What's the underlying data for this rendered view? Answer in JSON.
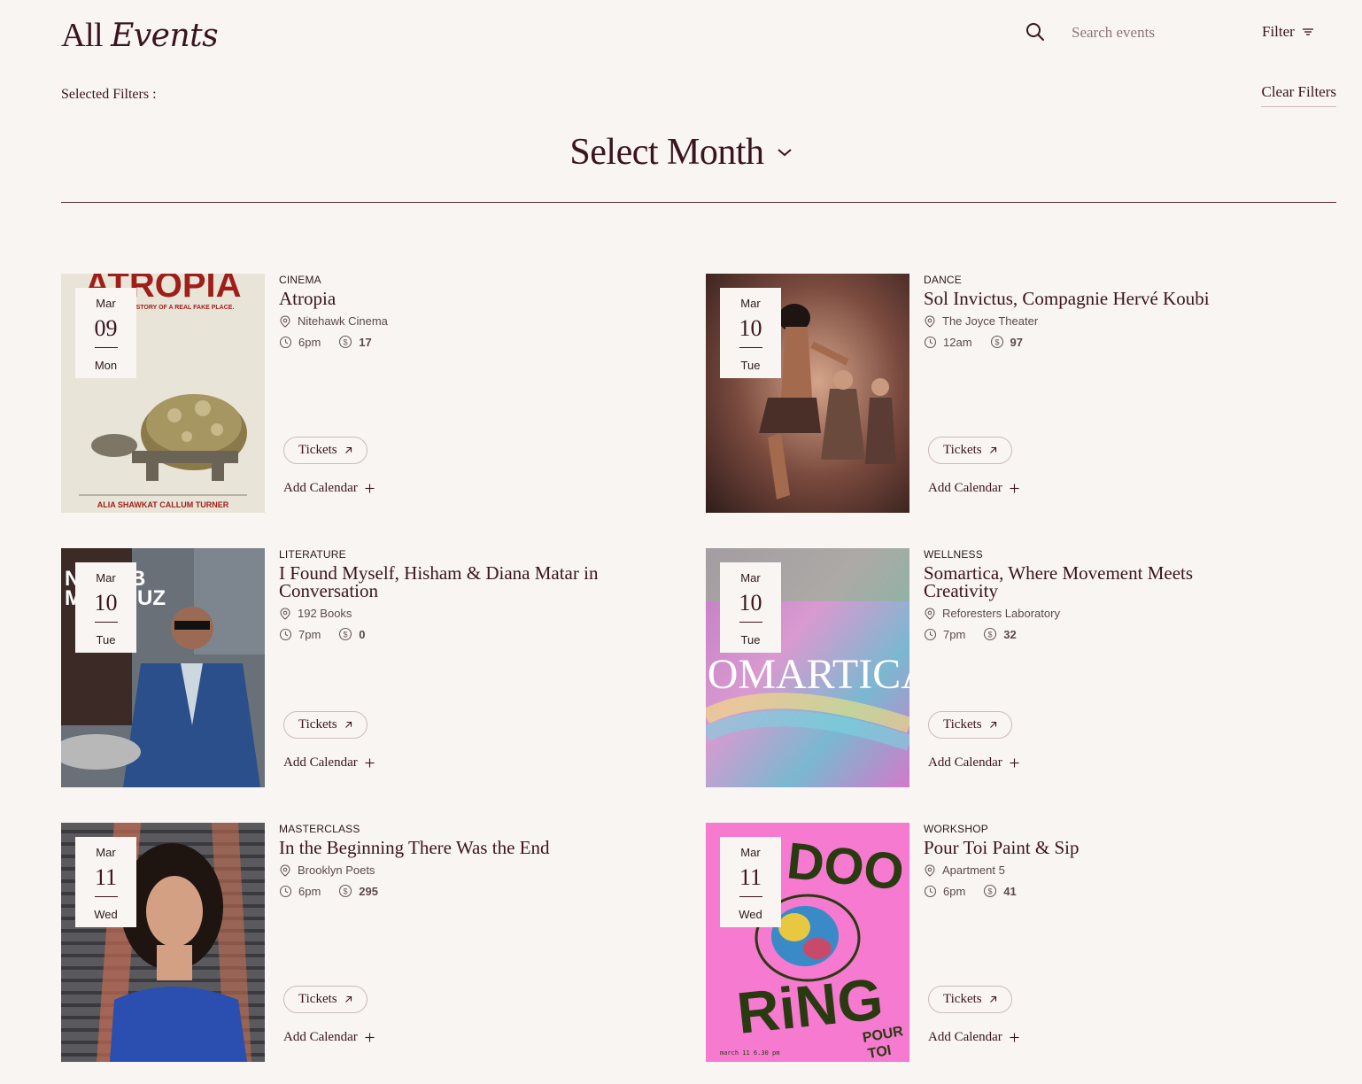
{
  "header": {
    "title_plain": "All",
    "title_italic": "Events",
    "search_placeholder": "Search events",
    "filter_label": "Filter"
  },
  "filters": {
    "selected_label": "Selected Filters :",
    "clear_label": "Clear Filters"
  },
  "month": {
    "label": "Select Month"
  },
  "events": [
    {
      "category": "CINEMA",
      "title": "Atropia",
      "venue": "Nitehawk Cinema",
      "time": "6pm",
      "price": "17",
      "month": "Mar",
      "day": "09",
      "weekday": "Mon",
      "tickets_label": "Tickets",
      "calendar_label": "Add Calendar",
      "poster_text": "ATROPIA",
      "poster_tagline": "STORY OF A REAL FAKE PLACE.",
      "poster_credits": "ALIA SHAWKAT   CALLUM TURNER"
    },
    {
      "category": "DANCE",
      "title": "Sol Invictus, Compagnie Hervé Koubi",
      "venue": "The Joyce Theater",
      "time": "12am",
      "price": "97",
      "month": "Mar",
      "day": "10",
      "weekday": "Tue",
      "tickets_label": "Tickets",
      "calendar_label": "Add Calendar"
    },
    {
      "category": "LITERATURE",
      "title": "I Found Myself, Hisham & Diana Matar in Conversation",
      "venue": "192 Books",
      "time": "7pm",
      "price": "0",
      "month": "Mar",
      "day": "10",
      "weekday": "Tue",
      "tickets_label": "Tickets",
      "calendar_label": "Add Calendar",
      "poster_text": "N  B  M  UZ"
    },
    {
      "category": "WELLNESS",
      "title": "Somartica, Where Movement Meets Creativity",
      "venue": "Reforesters Laboratory",
      "time": "7pm",
      "price": "32",
      "month": "Mar",
      "day": "10",
      "weekday": "Tue",
      "tickets_label": "Tickets",
      "calendar_label": "Add Calendar",
      "poster_text": "SOMARTICA"
    },
    {
      "category": "MASTERCLASS",
      "title": "In the Beginning There Was the End",
      "venue": "Brooklyn Poets",
      "time": "6pm",
      "price": "295",
      "month": "Mar",
      "day": "11",
      "weekday": "Wed",
      "tickets_label": "Tickets",
      "calendar_label": "Add Calendar"
    },
    {
      "category": "WORKSHOP",
      "title": "Pour Toi Paint & Sip",
      "venue": "Apartment 5",
      "time": "6pm",
      "price": "41",
      "month": "Mar",
      "day": "11",
      "weekday": "Wed",
      "tickets_label": "Tickets",
      "calendar_label": "Add Calendar",
      "poster_text": "DOOD RiNG",
      "poster_small": "march 11 6.30 pm",
      "poster_brand": "POUR TOI"
    }
  ],
  "colors": {
    "background": "#f8f5f2",
    "text": "#3a1420",
    "accent_pink": "#f57ad0"
  }
}
